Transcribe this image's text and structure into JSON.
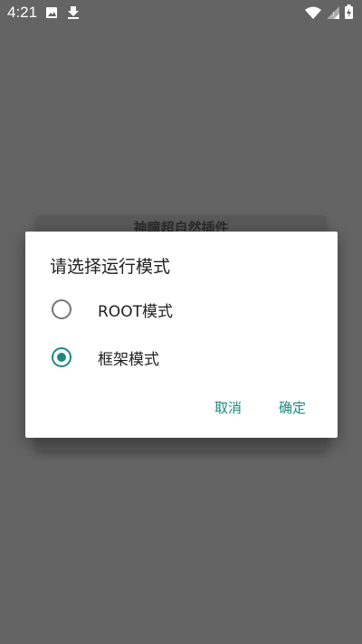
{
  "status_bar": {
    "time": "4:21",
    "left_icons": [
      "image-icon",
      "download-icon"
    ],
    "right_icons": [
      "wifi-icon",
      "signal-icon",
      "battery-icon"
    ]
  },
  "background": {
    "title": "神瞳超自然插件"
  },
  "dialog": {
    "title": "请选择运行模式",
    "options": [
      {
        "label": "ROOT模式",
        "selected": false
      },
      {
        "label": "框架模式",
        "selected": true
      }
    ],
    "cancel_label": "取消",
    "confirm_label": "确定"
  },
  "colors": {
    "accent": "#1a8a80",
    "scrim": "#646464"
  }
}
